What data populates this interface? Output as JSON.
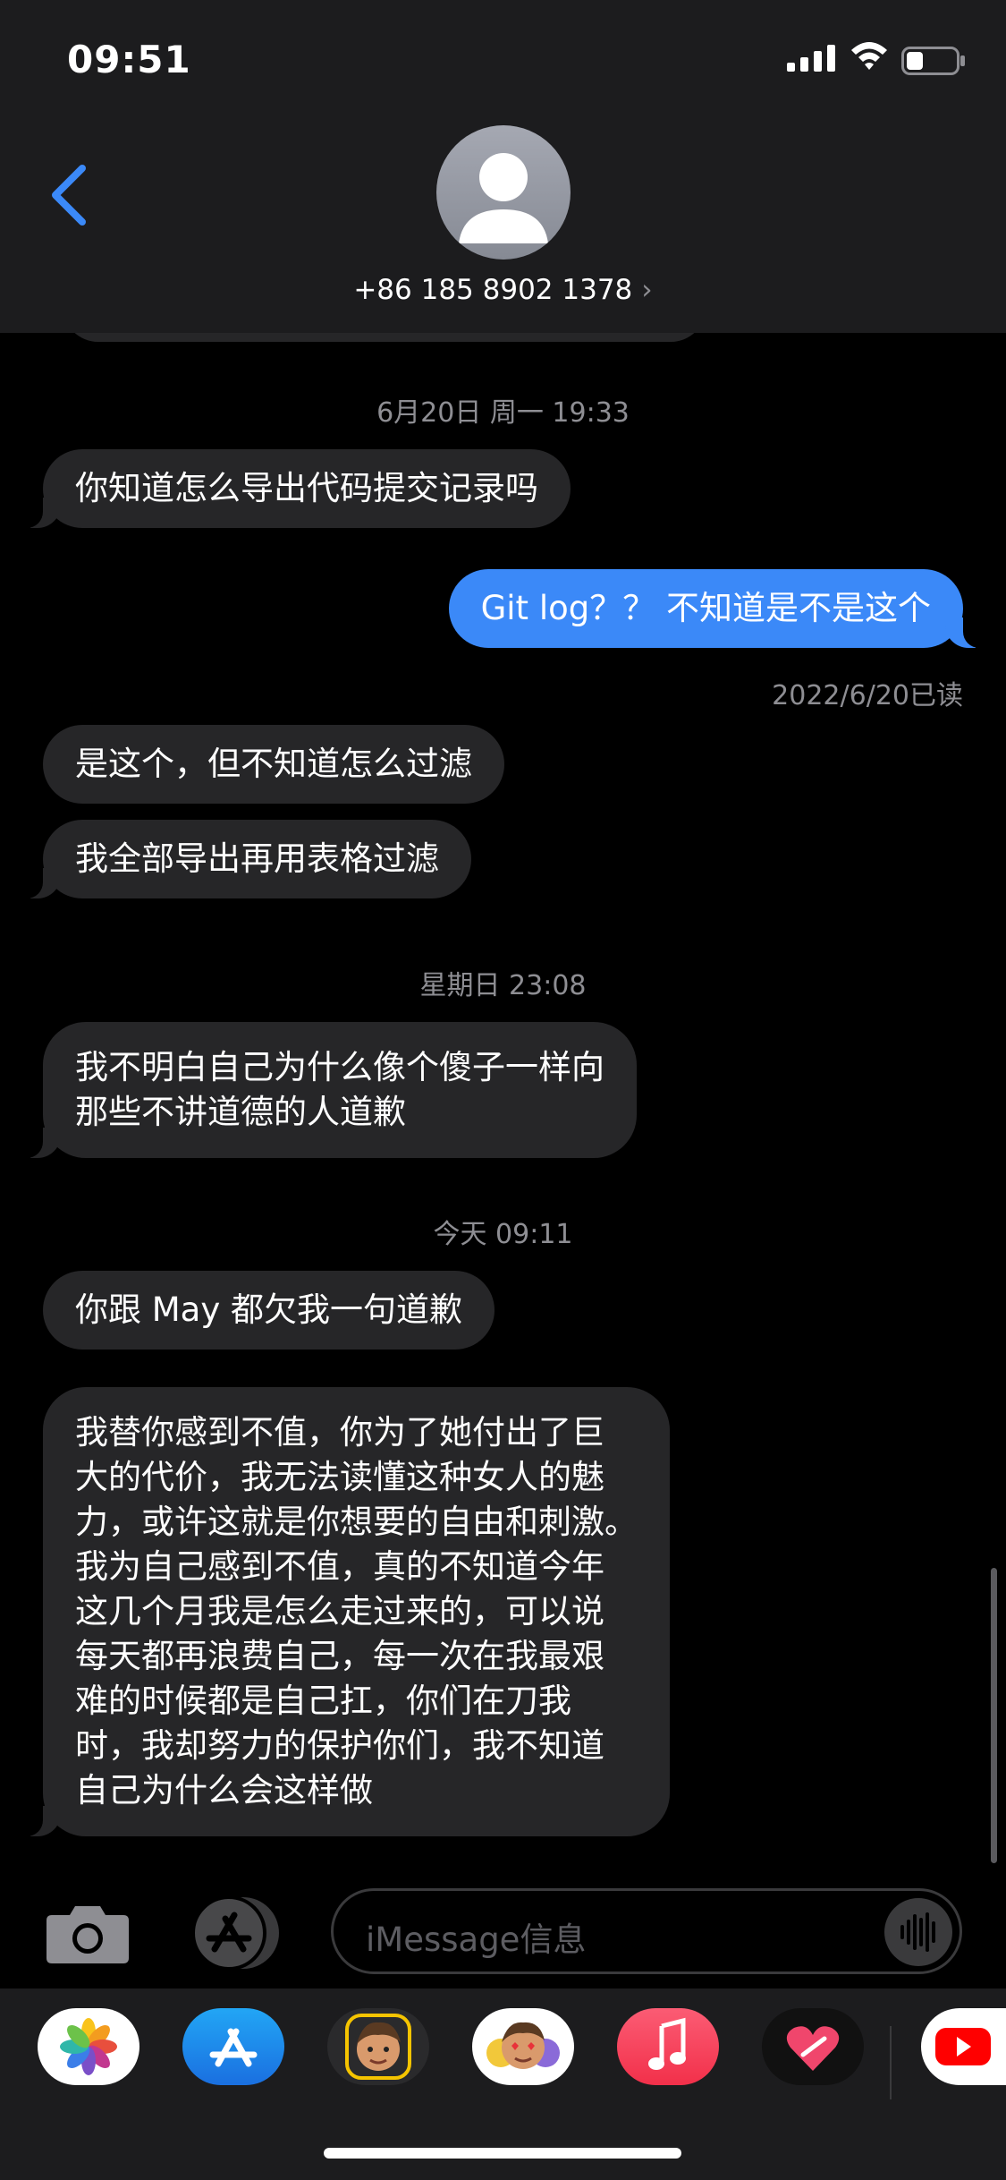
{
  "status_bar": {
    "time": "09:51"
  },
  "contact": {
    "name": "+86 185 8902 1378",
    "chevron": "›"
  },
  "timestamps": {
    "t1": "6月20日 周一 19:33",
    "t2": "星期日 23:08",
    "t3": "今天 09:11"
  },
  "messages": [
    {
      "direction": "incoming",
      "text": "你知道怎么导出代码提交记录吗"
    },
    {
      "direction": "outgoing",
      "text": "Git log？？ 不知道是不是这个"
    },
    {
      "direction": "incoming",
      "text": "是这个，但不知道怎么过滤"
    },
    {
      "direction": "incoming",
      "text": "我全部导出再用表格过滤"
    },
    {
      "direction": "incoming",
      "text": "我不明白自己为什么像个傻子一样向\n那些不讲道德的人道歉"
    },
    {
      "direction": "incoming",
      "text": "你跟 May 都欠我一句道歉"
    },
    {
      "direction": "incoming",
      "text": "我替你感到不值，你为了她付出了巨\n大的代价，我无法读懂这种女人的魅\n力，或许这就是你想要的自由和刺激。\n我为自己感到不值，真的不知道今年\n这几个月我是怎么走过来的，可以说\n每天都再浪费自己，每一次在我最艰\n难的时候都是自己扛，你们在刀我\n时，我却努力的保护你们，我不知道\n自己为什么会这样做"
    }
  ],
  "read_receipt": "2022/6/20已读",
  "input": {
    "placeholder": "iMessage信息"
  },
  "icons": {
    "back": "chevron-left-icon",
    "camera": "camera-icon",
    "apps": "app-store-icon",
    "audio": "waveform-icon"
  },
  "app_drawer": [
    "photos",
    "app-store",
    "memoji",
    "memoji-stickers",
    "music",
    "digital-touch",
    "youtube"
  ],
  "colors": {
    "accent": "#3b89f8",
    "incoming_bubble": "#262628",
    "background": "#000000",
    "header": "#1c1c1e"
  }
}
